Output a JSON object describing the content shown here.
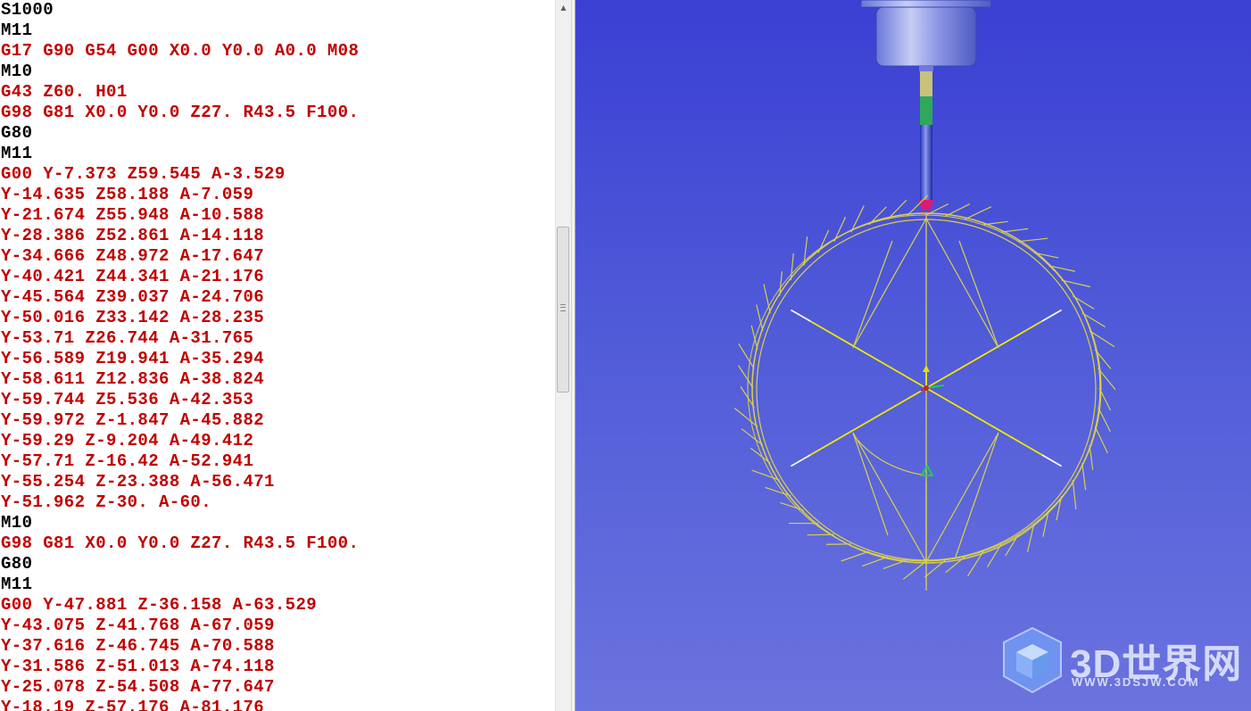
{
  "editor": {
    "lines": [
      {
        "text": "S1000",
        "kind": "m-code"
      },
      {
        "text": "M11",
        "kind": "m-code"
      },
      {
        "text": "G17 G90 G54 G00 X0.0 Y0.0 A0.0 M08",
        "kind": "g-code"
      },
      {
        "text": "M10",
        "kind": "m-code"
      },
      {
        "text": "G43 Z60. H01",
        "kind": "g-code"
      },
      {
        "text": "G98 G81 X0.0 Y0.0 Z27. R43.5 F100.",
        "kind": "g-code"
      },
      {
        "text": "G80",
        "kind": "m-code"
      },
      {
        "text": "M11",
        "kind": "m-code"
      },
      {
        "text": "G00 Y-7.373 Z59.545 A-3.529",
        "kind": "g-code"
      },
      {
        "text": "Y-14.635 Z58.188 A-7.059",
        "kind": "g-code"
      },
      {
        "text": "Y-21.674 Z55.948 A-10.588",
        "kind": "g-code"
      },
      {
        "text": "Y-28.386 Z52.861 A-14.118",
        "kind": "g-code"
      },
      {
        "text": "Y-34.666 Z48.972 A-17.647",
        "kind": "g-code"
      },
      {
        "text": "Y-40.421 Z44.341 A-21.176",
        "kind": "g-code"
      },
      {
        "text": "Y-45.564 Z39.037 A-24.706",
        "kind": "g-code"
      },
      {
        "text": "Y-50.016 Z33.142 A-28.235",
        "kind": "g-code"
      },
      {
        "text": "Y-53.71 Z26.744 A-31.765",
        "kind": "g-code"
      },
      {
        "text": "Y-56.589 Z19.941 A-35.294",
        "kind": "g-code"
      },
      {
        "text": "Y-58.611 Z12.836 A-38.824",
        "kind": "g-code"
      },
      {
        "text": "Y-59.744 Z5.536 A-42.353",
        "kind": "g-code"
      },
      {
        "text": "Y-59.972 Z-1.847 A-45.882",
        "kind": "g-code"
      },
      {
        "text": "Y-59.29 Z-9.204 A-49.412",
        "kind": "g-code"
      },
      {
        "text": "Y-57.71 Z-16.42 A-52.941",
        "kind": "g-code"
      },
      {
        "text": "Y-55.254 Z-23.388 A-56.471",
        "kind": "g-code"
      },
      {
        "text": "Y-51.962 Z-30. A-60.",
        "kind": "g-code"
      },
      {
        "text": "M10",
        "kind": "m-code"
      },
      {
        "text": "G98 G81 X0.0 Y0.0 Z27. R43.5 F100.",
        "kind": "g-code"
      },
      {
        "text": "G80",
        "kind": "m-code"
      },
      {
        "text": "M11",
        "kind": "m-code"
      },
      {
        "text": "G00 Y-47.881 Z-36.158 A-63.529",
        "kind": "g-code"
      },
      {
        "text": "Y-43.075 Z-41.768 A-67.059",
        "kind": "g-code"
      },
      {
        "text": "Y-37.616 Z-46.745 A-70.588",
        "kind": "g-code"
      },
      {
        "text": "Y-31.586 Z-51.013 A-74.118",
        "kind": "g-code"
      },
      {
        "text": "Y-25.078 Z-54.508 A-77.647",
        "kind": "g-code"
      },
      {
        "text": "Y-18.19 Z-57.176 A-81.176",
        "kind": "g-code"
      }
    ]
  },
  "scrollbar": {
    "up_icon": "scroll-up-arrow-icon",
    "position_fraction": 0.32
  },
  "viewport": {
    "background_top": "#3b3fd3",
    "background_bottom": "#6b73de",
    "toolpath_color": "#d9d04a",
    "axis_x_color": "#cc2222",
    "axis_y_color": "#22cc44",
    "axis_z_color": "#e6e000",
    "rapid_colors": [
      "#ffffff"
    ],
    "tool_stripes": [
      "#c9c27a",
      "#2fa85c",
      "#2f3fd6",
      "#d81b7a"
    ]
  },
  "watermark": {
    "logo": "3d-cube-logo-icon",
    "text": "3D世界网",
    "url": "WWW.3DSJW.COM"
  }
}
